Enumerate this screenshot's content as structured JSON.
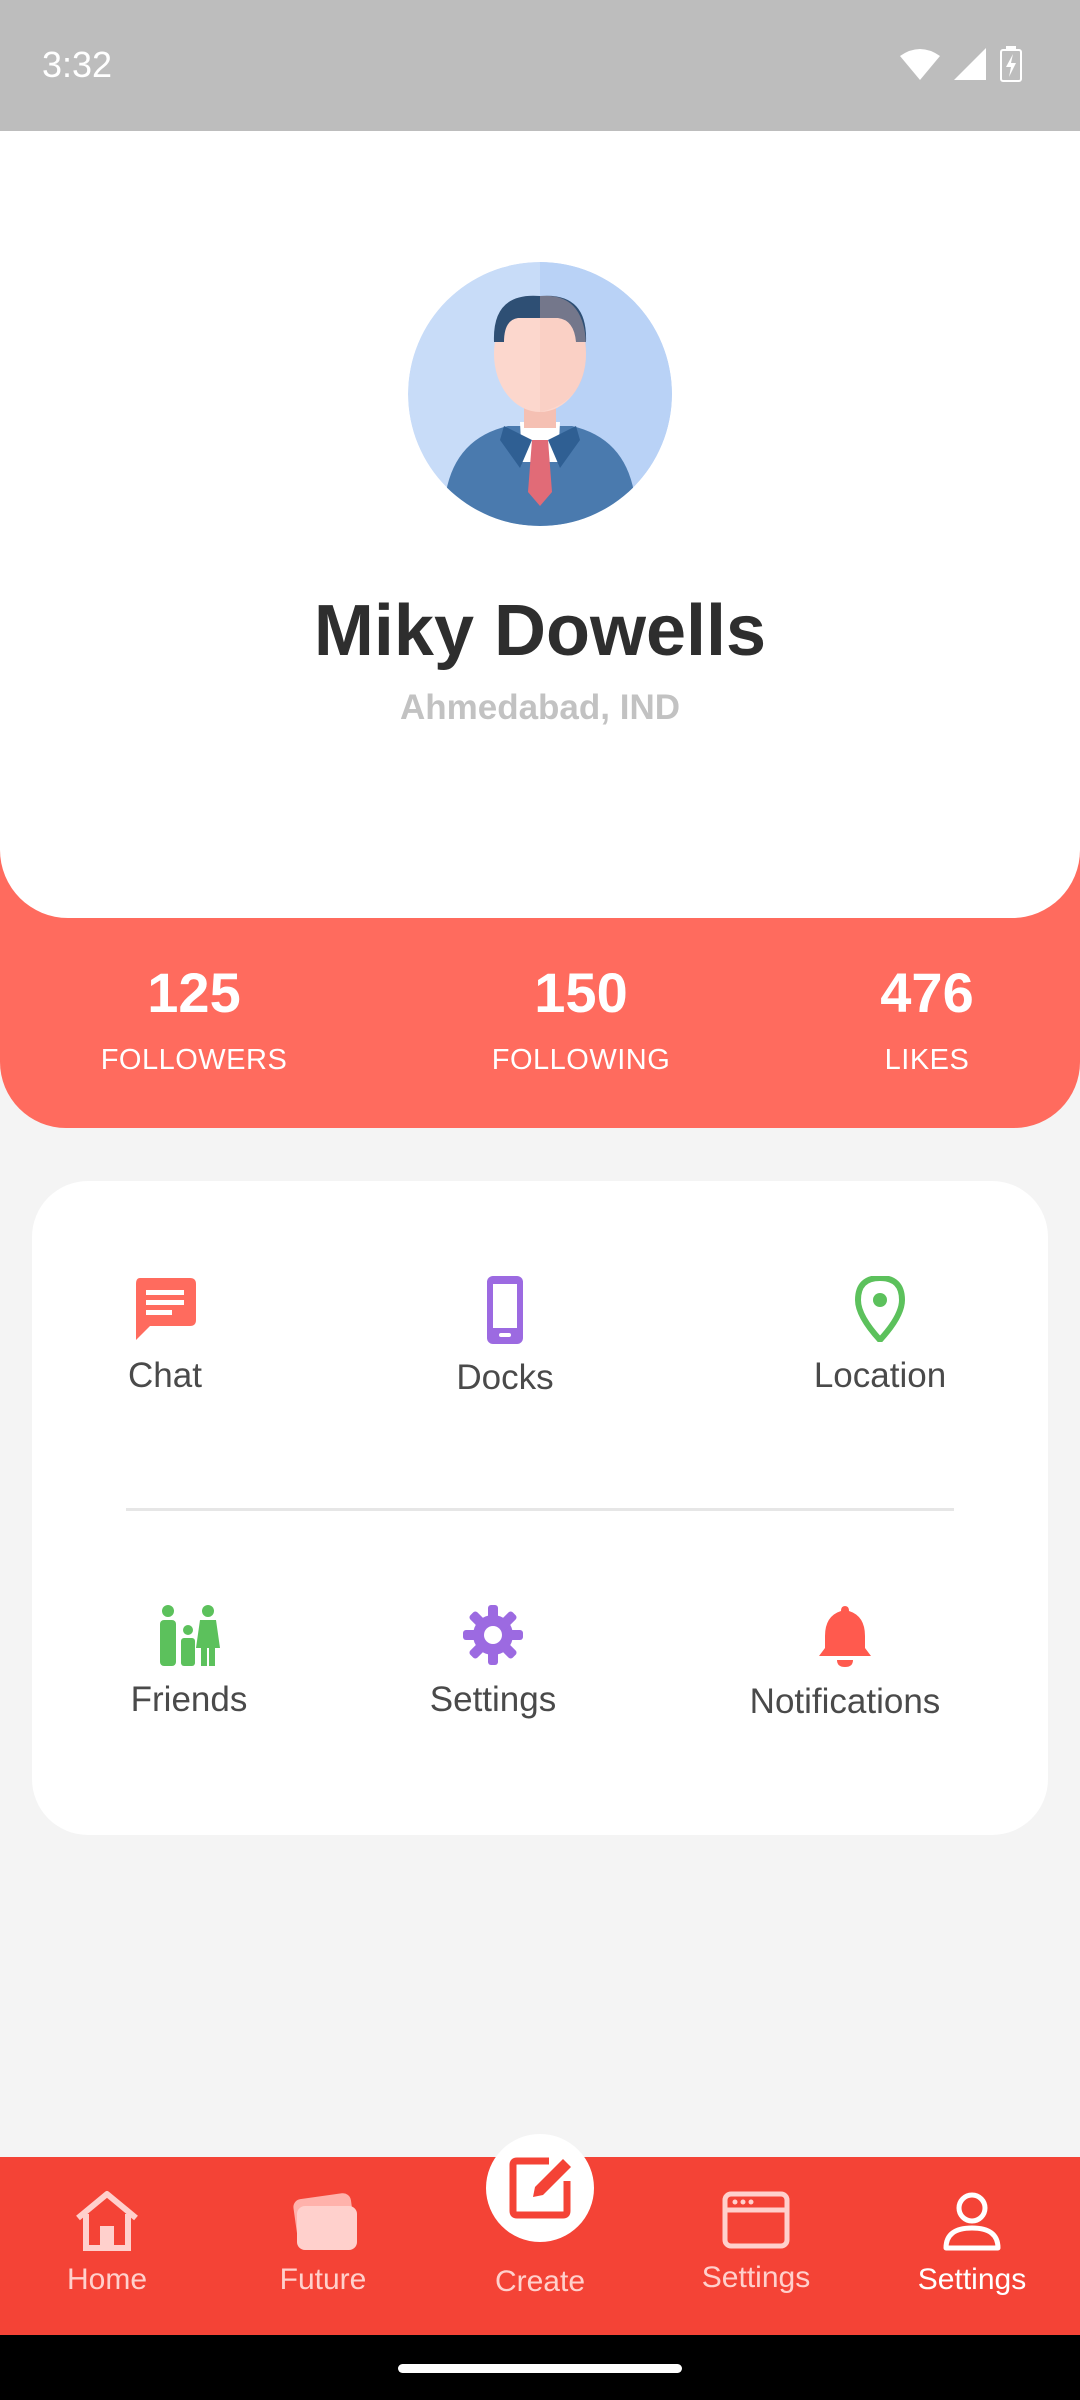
{
  "status_bar": {
    "time": "3:32"
  },
  "profile": {
    "name": "Miky Dowells",
    "location": "Ahmedabad, IND",
    "avatar_icon": "businessman-avatar"
  },
  "stats": [
    {
      "value": "125",
      "label": "FOLLOWERS"
    },
    {
      "value": "150",
      "label": "FOLLOWING"
    },
    {
      "value": "476",
      "label": "LIKES"
    }
  ],
  "menu": {
    "row1": [
      {
        "label": "Chat",
        "icon": "chat-icon",
        "color": "#ff6b5e"
      },
      {
        "label": "Docks",
        "icon": "phone-icon",
        "color": "#9c6ae1"
      },
      {
        "label": "Location",
        "icon": "location-pin-icon",
        "color": "#5cc15c"
      }
    ],
    "row2": [
      {
        "label": "Friends",
        "icon": "family-icon",
        "color": "#5cc15c"
      },
      {
        "label": "Settings",
        "icon": "gear-icon",
        "color": "#9c6ae1"
      },
      {
        "label": "Notifications",
        "icon": "bell-icon",
        "color": "#ff5a4e"
      }
    ]
  },
  "bottom_nav": {
    "items": [
      {
        "label": "Home",
        "icon": "home-icon"
      },
      {
        "label": "Future",
        "icon": "cards-icon"
      },
      {
        "label": "Create",
        "icon": "edit-icon"
      },
      {
        "label": "Settings",
        "icon": "browser-window-icon"
      },
      {
        "label": "Settings",
        "icon": "person-icon",
        "active": true
      }
    ]
  },
  "colors": {
    "accent": "#ff6b5e",
    "nav": "#f44336",
    "status_bar": "#bdbdbd"
  }
}
